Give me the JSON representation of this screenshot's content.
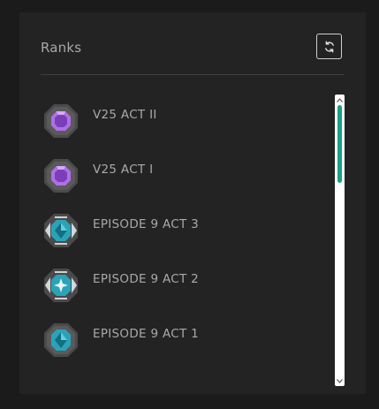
{
  "panel": {
    "title": "Ranks",
    "refresh_icon": "refresh-icon"
  },
  "ranks": [
    {
      "label": "V25 ACT II",
      "icon": "amethyst-rank-icon",
      "gem_color": "#b06fe6"
    },
    {
      "label": "V25 ACT I",
      "icon": "amethyst-rank-icon",
      "gem_color": "#b06fe6"
    },
    {
      "label": "EPISODE 9 ACT 3",
      "icon": "teal-winged-rank-icon",
      "gem_color": "#2aa3b8"
    },
    {
      "label": "EPISODE 9 ACT 2",
      "icon": "teal-star-winged-rank-icon",
      "gem_color": "#2aa3b8"
    },
    {
      "label": "EPISODE 9 ACT 1",
      "icon": "teal-rank-icon",
      "gem_color": "#2aa3b8"
    }
  ],
  "scrollbar": {
    "thumb_color": "#1aa087",
    "position_fraction": 0.0,
    "visible_fraction": 0.3
  }
}
